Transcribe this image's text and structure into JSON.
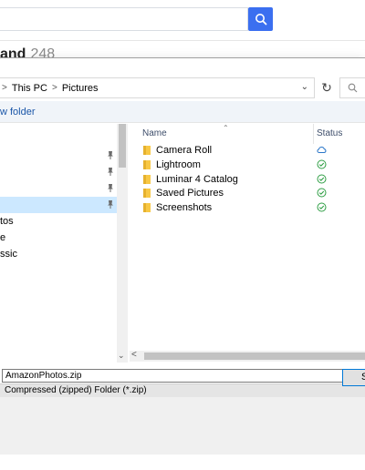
{
  "background": {
    "heading_bold": "and",
    "heading_count": "248",
    "accent": "#3b6ff0"
  },
  "dialog": {
    "breadcrumb": [
      "This PC",
      "Pictures"
    ],
    "breadcrumb_separator": ">",
    "command_new_folder": "w folder",
    "nav_items": [
      {
        "label": "",
        "pinned": true,
        "selected": false
      },
      {
        "label": "",
        "pinned": true,
        "selected": false
      },
      {
        "label": "",
        "pinned": true,
        "selected": false
      },
      {
        "label": "",
        "pinned": true,
        "selected": true
      },
      {
        "label": "tos",
        "pinned": false,
        "selected": false
      },
      {
        "label": "e",
        "pinned": false,
        "selected": false
      },
      {
        "label": "ssic",
        "pinned": false,
        "selected": false
      }
    ],
    "columns": {
      "name": "Name",
      "status": "Status"
    },
    "files": [
      {
        "name": "Camera Roll",
        "status": "cloud-icon"
      },
      {
        "name": "Lightroom",
        "status": "synced-check-icon"
      },
      {
        "name": "Luminar 4 Catalog",
        "status": "synced-check-icon"
      },
      {
        "name": "Saved Pictures",
        "status": "synced-check-icon"
      },
      {
        "name": "Screenshots",
        "status": "synced-check-icon"
      }
    ],
    "file_name_value": "AmazonPhotos.zip",
    "save_as_type": "Compressed (zipped) Folder (*.zip)",
    "save_button_label": "S",
    "folder_color": "#f8c845",
    "check_color": "#2e9e44",
    "cloud_color": "#2b77c9"
  }
}
